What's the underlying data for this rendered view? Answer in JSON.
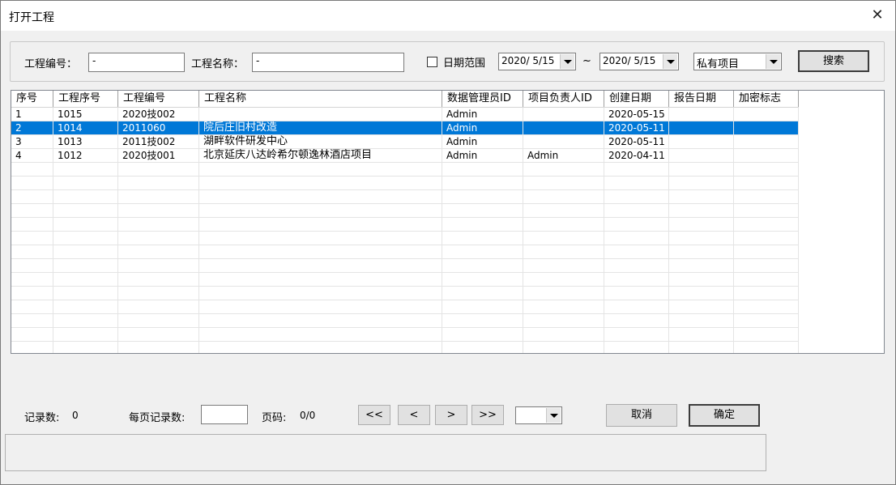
{
  "window": {
    "title": "打开工程",
    "close_glyph": "✕"
  },
  "search": {
    "code_label": "工程编号：",
    "code_value": "-",
    "name_label": "工程名称：",
    "name_value": "-",
    "date_range_label": "日期范围",
    "date_range_checked": false,
    "date_from": "2020/ 5/15",
    "date_sep": "~",
    "date_to": "2020/ 5/15",
    "scope_value": "私有项目",
    "search_button": "搜索"
  },
  "table": {
    "columns": [
      "序号",
      "工程序号",
      "工程编号",
      "工程名称",
      "数据管理员ID",
      "项目负责人ID",
      "创建日期",
      "报告日期",
      "加密标志"
    ],
    "rows": [
      [
        "1",
        "1015",
        "2020技002",
        "",
        "Admin",
        "",
        "2020-05-15",
        "",
        ""
      ],
      [
        "2",
        "1014",
        "2011060",
        "院后庄旧村改造",
        "Admin",
        "",
        "2020-05-11",
        "",
        ""
      ],
      [
        "3",
        "1013",
        "2011技002",
        "湖畔软件研发中心",
        "Admin",
        "",
        "2020-05-11",
        "",
        ""
      ],
      [
        "4",
        "1012",
        "2020技001",
        "北京延庆八达岭希尔顿逸林酒店项目",
        "Admin",
        "Admin",
        "2020-04-11",
        "",
        ""
      ]
    ],
    "selected_row_index": 1,
    "empty_rows": 14
  },
  "footer": {
    "record_count_label": "记录数:",
    "record_count_value": "0",
    "page_size_label": "每页记录数:",
    "page_size_value": "",
    "page_label": "页码:",
    "page_value": "0/0",
    "first_button": "<<",
    "prev_button": "<",
    "next_button": ">",
    "last_button": ">>",
    "page_select_value": "",
    "cancel_button": "取消",
    "ok_button": "确定"
  },
  "colors": {
    "selection": "#0078d7",
    "background": "#f0f0f0"
  }
}
